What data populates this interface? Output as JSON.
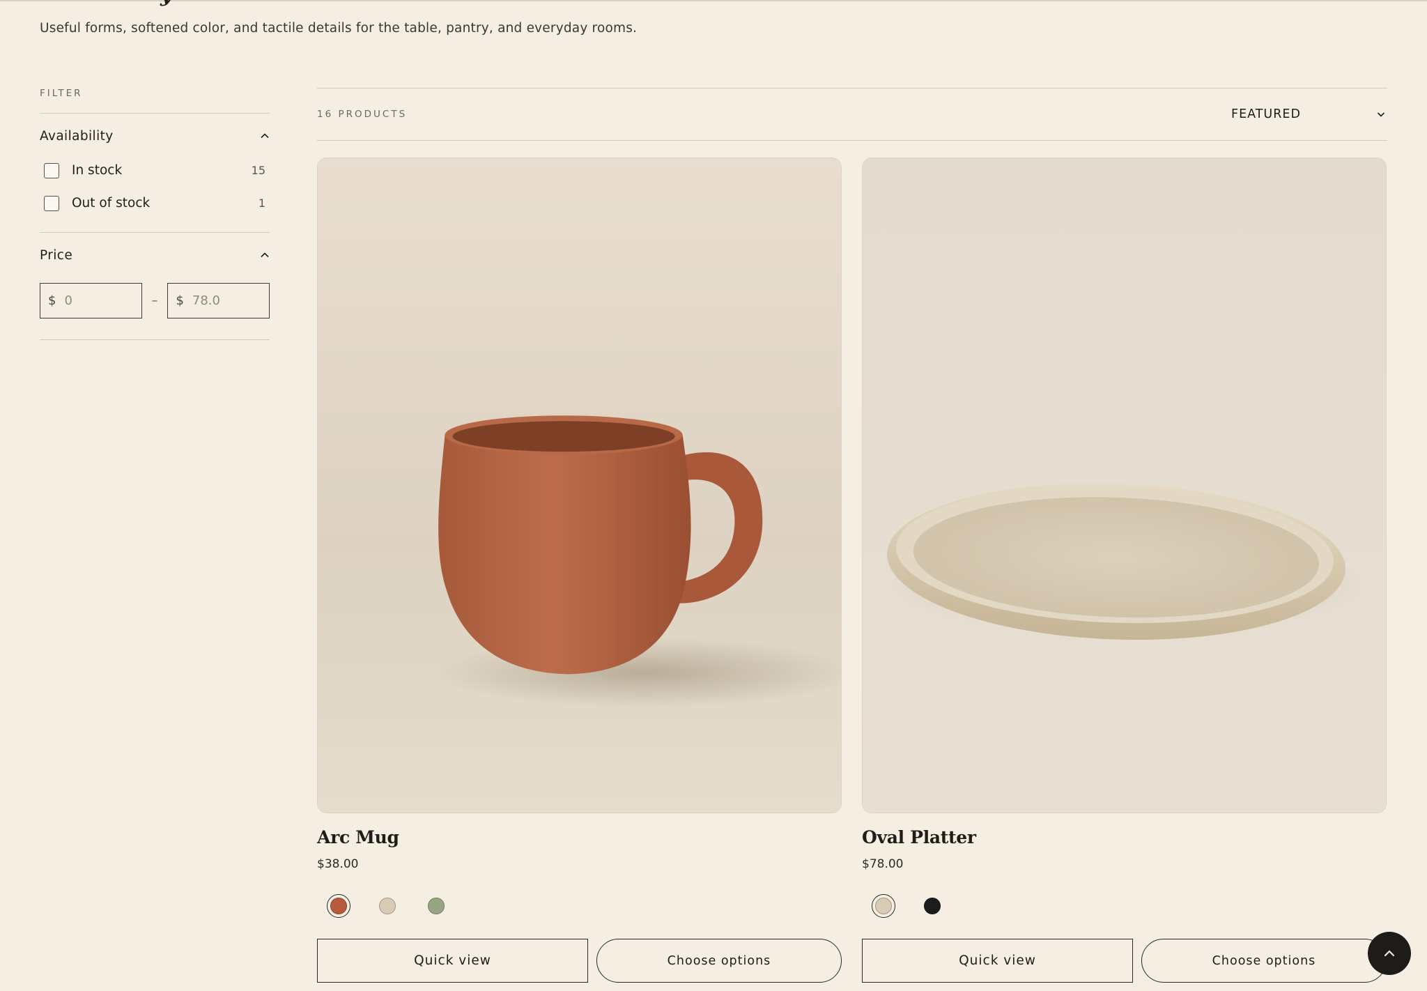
{
  "header": {
    "title_peek": "y",
    "subtitle": "Useful forms, softened color, and tactile details for the table, pantry, and everyday rooms."
  },
  "sidebar": {
    "filter_heading": "FILTER",
    "availability": {
      "label": "Availability",
      "options": [
        {
          "label": "In stock",
          "count": "15"
        },
        {
          "label": "Out of stock",
          "count": "1"
        }
      ]
    },
    "price": {
      "label": "Price",
      "currency": "$",
      "min_placeholder": "0",
      "max_placeholder": "78.0",
      "separator": "–"
    }
  },
  "toolbar": {
    "product_count": "16 PRODUCTS",
    "sort_label": "FEATURED"
  },
  "products": [
    {
      "title": "Arc Mug",
      "price": "$38.00",
      "image_icon": "terracotta-mug",
      "swatches": [
        {
          "color": "#b85a3c",
          "selected": true
        },
        {
          "color": "#d8ccb4",
          "selected": false
        },
        {
          "color": "#98a582",
          "selected": false
        }
      ],
      "quick_view": "Quick view",
      "choose_options": "Choose options"
    },
    {
      "title": "Oval Platter",
      "price": "$78.00",
      "image_icon": "oval-platter",
      "swatches": [
        {
          "color": "#d8ccb4",
          "selected": true
        },
        {
          "color": "#1c1b1e",
          "selected": false
        }
      ],
      "quick_view": "Quick view",
      "choose_options": "Choose options"
    }
  ],
  "colors": {
    "background": "#f5efe3",
    "text": "#1f1d1a",
    "rule": "#d3c9b8"
  }
}
